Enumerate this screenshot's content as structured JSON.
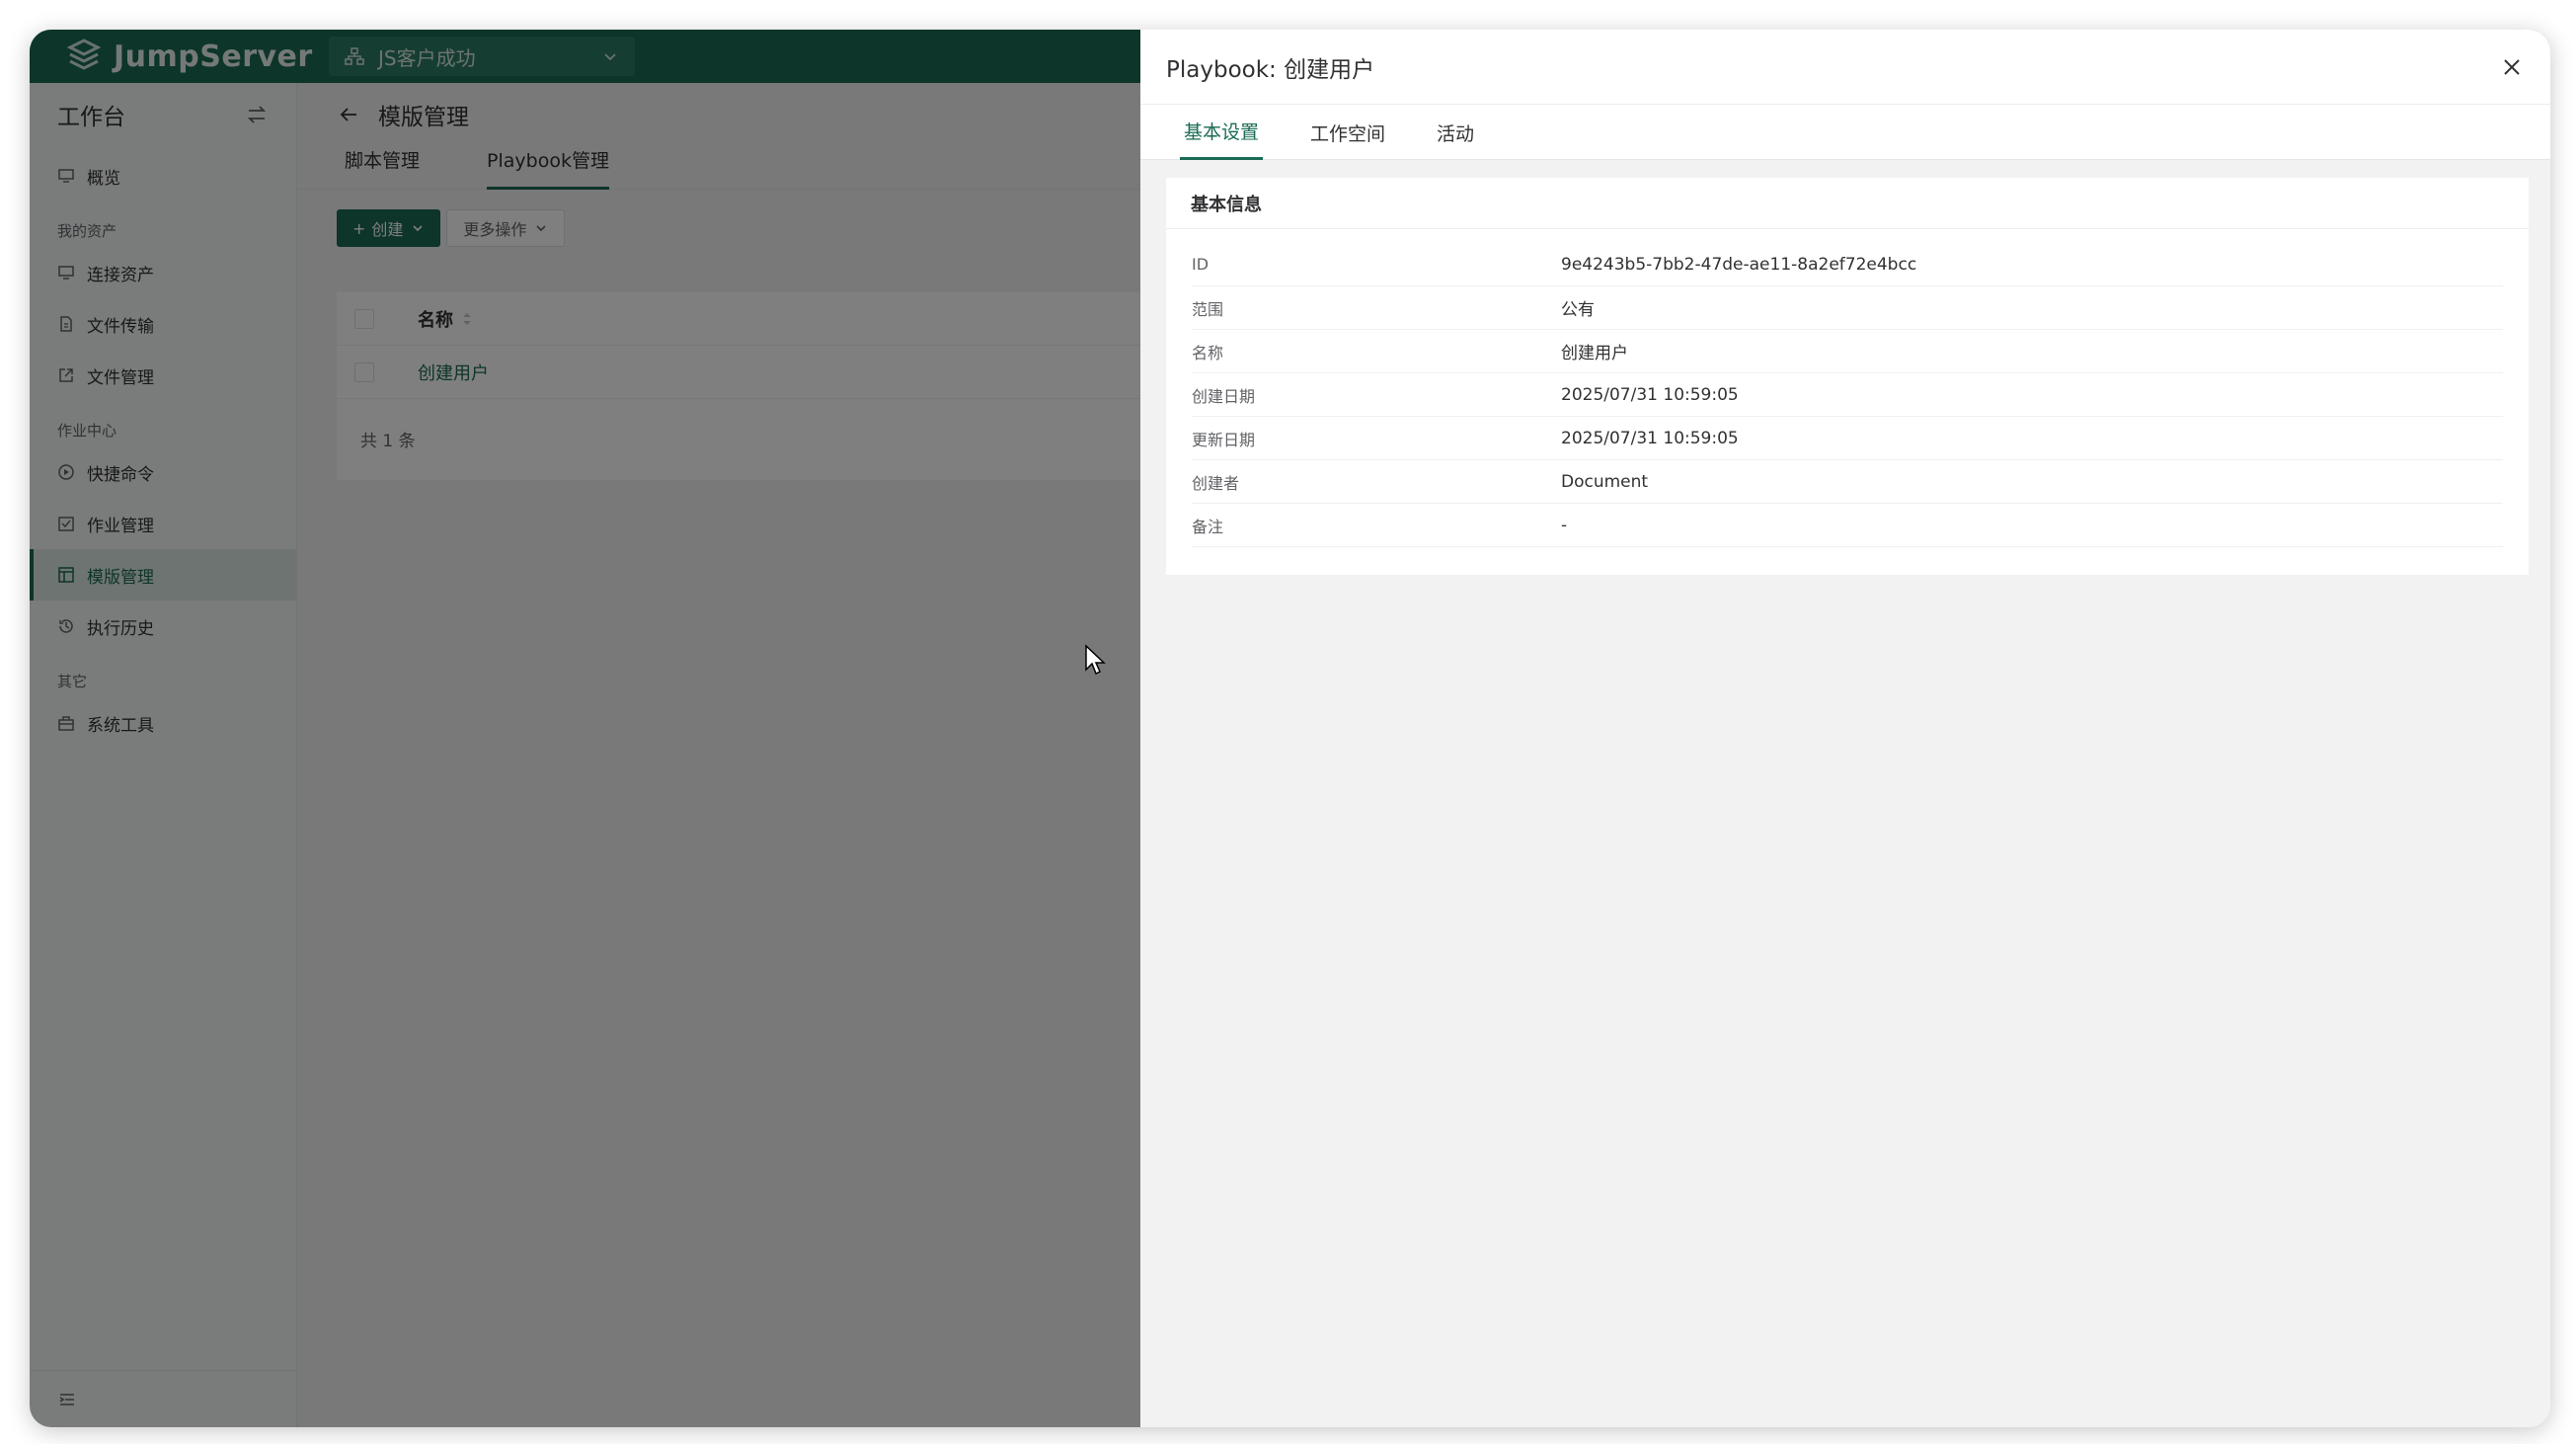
{
  "topbar": {
    "logo_text": "JumpServer",
    "org_name": "JS客户成功"
  },
  "sidebar": {
    "title": "工作台",
    "groups": [
      {
        "label": ""
      },
      {
        "label": "我的资产"
      },
      {
        "label": "作业中心"
      },
      {
        "label": "其它"
      }
    ],
    "items": [
      {
        "label": "概览",
        "icon": "monitor-icon"
      },
      {
        "label": "连接资产",
        "icon": "monitor-icon"
      },
      {
        "label": "文件传输",
        "icon": "file-icon"
      },
      {
        "label": "文件管理",
        "icon": "external-link-icon"
      },
      {
        "label": "快捷命令",
        "icon": "play-circle-icon"
      },
      {
        "label": "作业管理",
        "icon": "checklist-icon"
      },
      {
        "label": "模版管理",
        "icon": "template-icon",
        "active": true
      },
      {
        "label": "执行历史",
        "icon": "history-icon"
      },
      {
        "label": "系统工具",
        "icon": "toolbox-icon"
      }
    ]
  },
  "main": {
    "page_title": "模版管理",
    "tabs": [
      {
        "label": "脚本管理"
      },
      {
        "label": "Playbook管理",
        "active": true
      }
    ],
    "create_label": "创建",
    "more_label": "更多操作",
    "table": {
      "header_name": "名称",
      "rows": [
        {
          "name": "创建用户"
        }
      ],
      "total": "共 1 条"
    }
  },
  "drawer": {
    "title": "Playbook: 创建用户",
    "tabs": [
      {
        "label": "基本设置",
        "active": true
      },
      {
        "label": "工作空间"
      },
      {
        "label": "活动"
      }
    ],
    "card_title": "基本信息",
    "fields": [
      {
        "label": "ID",
        "value": "9e4243b5-7bb2-47de-ae11-8a2ef72e4bcc"
      },
      {
        "label": "范围",
        "value": "公有"
      },
      {
        "label": "名称",
        "value": "创建用户"
      },
      {
        "label": "创建日期",
        "value": "2025/07/31 10:59:05"
      },
      {
        "label": "更新日期",
        "value": "2025/07/31 10:59:05"
      },
      {
        "label": "创建者",
        "value": "Document"
      },
      {
        "label": "备注",
        "value": "-"
      }
    ]
  },
  "colors": {
    "brand": "#1a6b55",
    "overlay": "rgba(0,0,0,0.5)"
  }
}
